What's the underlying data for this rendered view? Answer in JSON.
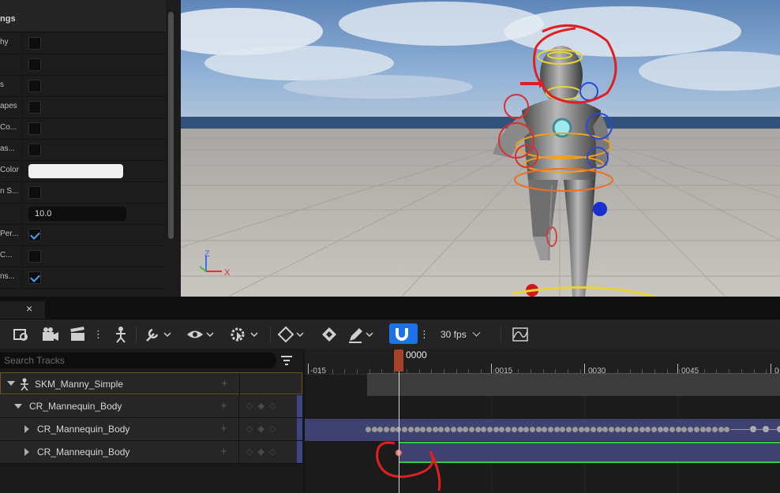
{
  "details": {
    "header": "ngs",
    "rows": [
      {
        "label": "hy",
        "type": "checkbox",
        "checked": false
      },
      {
        "label": "",
        "type": "checkbox",
        "checked": false
      },
      {
        "label": "s",
        "type": "checkbox",
        "checked": false
      },
      {
        "label": "apes",
        "type": "checkbox",
        "checked": false
      },
      {
        "label": "Co...",
        "type": "checkbox",
        "checked": false
      },
      {
        "label": "as...",
        "type": "checkbox",
        "checked": false
      },
      {
        "label": "Color",
        "type": "color",
        "value": "#f0f0f0"
      },
      {
        "label": "n S...",
        "type": "checkbox",
        "checked": false
      },
      {
        "label": "",
        "type": "number",
        "value": "10.0"
      },
      {
        "label": "Per...",
        "type": "checkbox",
        "checked": true
      },
      {
        "label": "C...",
        "type": "checkbox",
        "checked": false
      },
      {
        "label": "ns...",
        "type": "checkbox",
        "checked": true
      }
    ]
  },
  "viewport": {
    "axis": {
      "z": "Z",
      "x": "X"
    }
  },
  "sequencer": {
    "tab_close": "×",
    "fps_label": "30 fps",
    "search_placeholder": "Search Tracks",
    "tracks": [
      {
        "name": "SKM_Manny_Simple",
        "indent": "root"
      },
      {
        "name": "CR_Mannequin_Body",
        "indent": "child"
      },
      {
        "name": "CR_Mannequin_Body",
        "indent": "grandchild"
      },
      {
        "name": "CR_Mannequin_Body",
        "indent": "grandchild"
      }
    ],
    "ruler": {
      "current_frame": "0000",
      "ticks": [
        "-015",
        "0015",
        "0030",
        "0045",
        "0"
      ]
    },
    "colors": {
      "snap_active": "#1a73e8",
      "playhead": "#a9402a",
      "section": "#3f4270",
      "curve": "#2ecc40",
      "annotation": "#e02020"
    }
  }
}
